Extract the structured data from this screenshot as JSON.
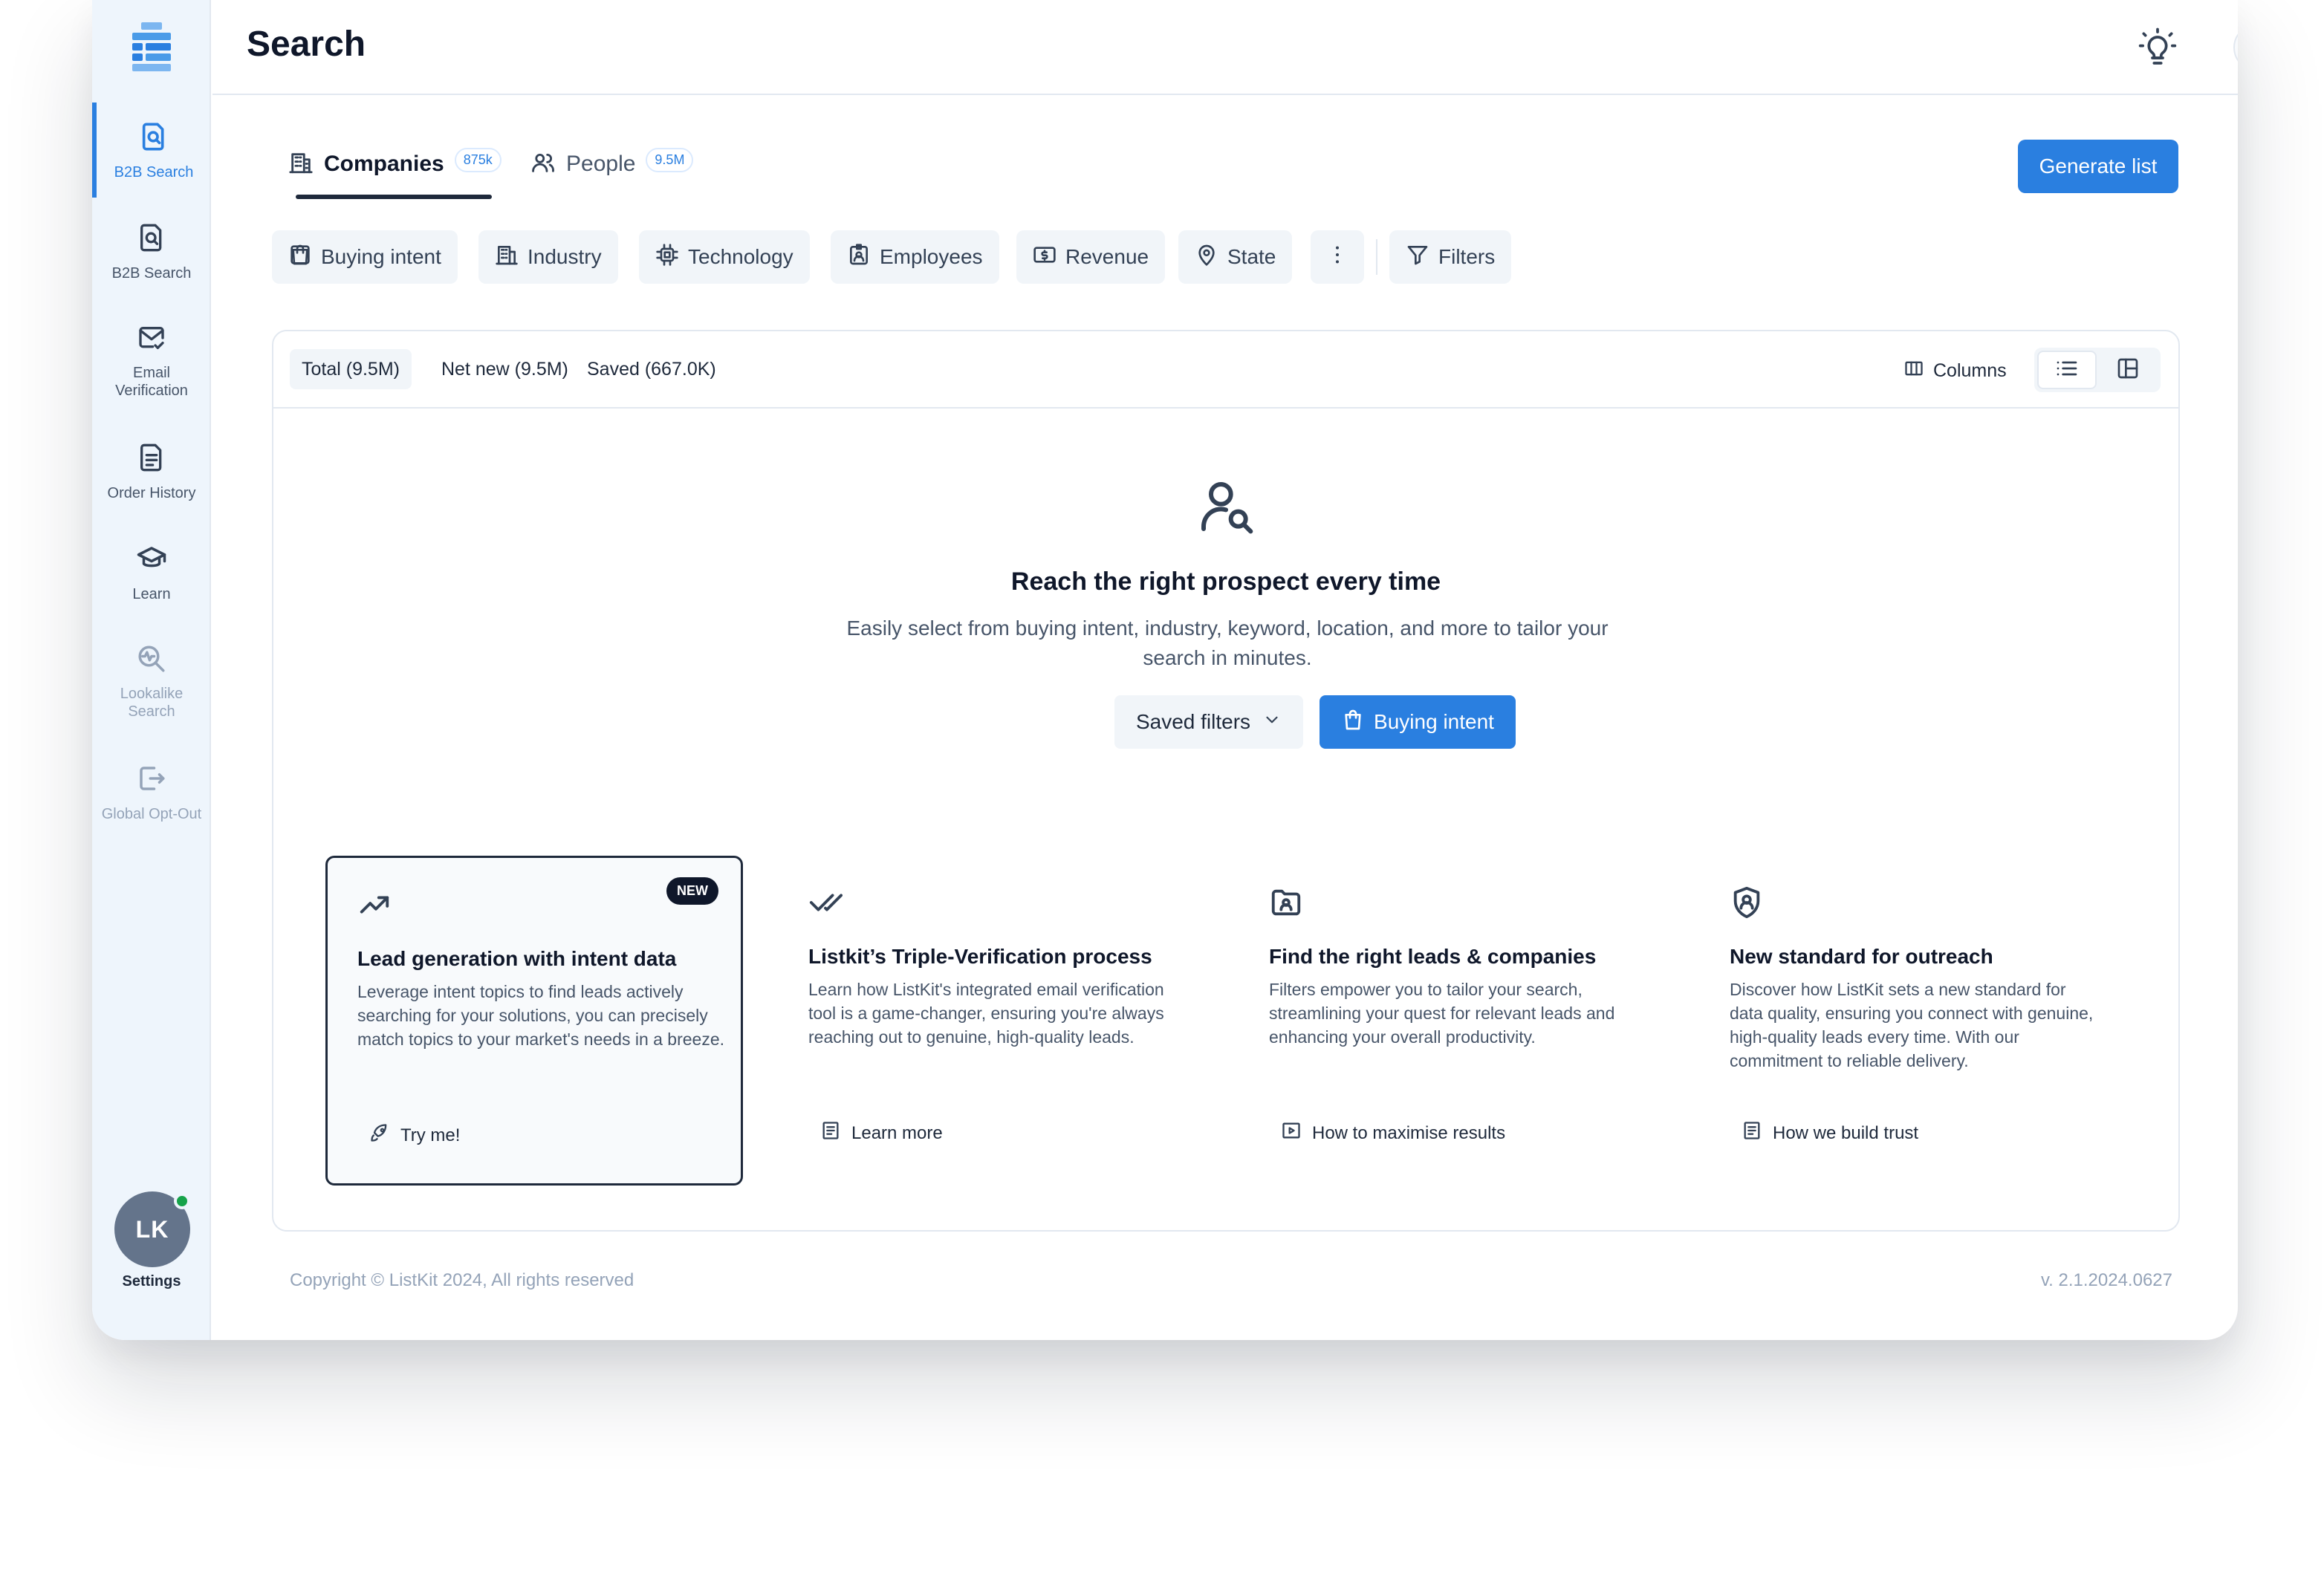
{
  "colors": {
    "accent": "#2a7fe0",
    "sidebar_bg": "#eef5fc",
    "dark": "#0f172a",
    "online": "#16a34a"
  },
  "sidebar": {
    "items": [
      {
        "label": "B2B Search",
        "icon": "search-document-icon",
        "active": true
      },
      {
        "label": "B2B Search",
        "icon": "search-document-icon",
        "active": false
      },
      {
        "label": "Email Verification",
        "icon": "mail-check-icon",
        "active": false
      },
      {
        "label": "Order History",
        "icon": "document-list-icon",
        "active": false
      },
      {
        "label": "Learn",
        "icon": "graduation-cap-icon",
        "active": false
      },
      {
        "label": "Lookalike Search",
        "icon": "lookalike-search-icon",
        "active": false,
        "muted": true
      },
      {
        "label": "Global Opt-Out",
        "icon": "logout-icon",
        "active": false,
        "muted": true
      }
    ],
    "avatar_initials": "LK",
    "settings_label": "Settings"
  },
  "header": {
    "title": "Search",
    "bulb_icon": "lightbulb-icon",
    "theme_icons": [
      "sun-icon",
      "moon-icon"
    ]
  },
  "tabs": [
    {
      "label": "Companies",
      "badge": "875k",
      "icon": "building-icon",
      "active": true
    },
    {
      "label": "People",
      "badge": "9.5M",
      "icon": "users-icon",
      "active": false
    }
  ],
  "generate_button": "Generate list",
  "filters": [
    {
      "label": "Buying intent",
      "icon": "shopping-bag-icon"
    },
    {
      "label": "Industry",
      "icon": "building-icon"
    },
    {
      "label": "Technology",
      "icon": "chip-icon"
    },
    {
      "label": "Employees",
      "icon": "id-badge-icon"
    },
    {
      "label": "Revenue",
      "icon": "dollar-note-icon"
    },
    {
      "label": "State",
      "icon": "map-pin-icon"
    },
    {
      "label": "",
      "icon": "more-vertical-icon"
    },
    {
      "label": "Filters",
      "icon": "funnel-icon"
    }
  ],
  "results": {
    "counts": [
      {
        "label": "Total (9.5M)",
        "active": true
      },
      {
        "label": "Net new (9.5M)",
        "active": false
      },
      {
        "label": "Saved (667.0K)",
        "active": false
      }
    ],
    "columns_label": "Columns",
    "empty_title": "Reach the right prospect every time",
    "empty_desc": "Easily select from buying intent, industry, keyword, location, and more to tailor your search in minutes.",
    "saved_filters_label": "Saved filters",
    "buying_intent_label": "Buying intent"
  },
  "cards": [
    {
      "icon": "trending-up-icon",
      "badge": "NEW",
      "title": "Lead generation with intent data",
      "desc": "Leverage intent topics to find leads actively searching for your solutions, you can precisely match topics to your market's needs in a breeze.",
      "link": "Try me!",
      "link_icon": "rocket-icon"
    },
    {
      "icon": "double-check-icon",
      "title": "Listkit’s Triple-Verification process",
      "desc": "Learn how ListKit's integrated email verification tool is a game-changer, ensuring you're always reaching out to genuine, high-quality leads.",
      "link": "Learn more",
      "link_icon": "article-icon"
    },
    {
      "icon": "folder-user-icon",
      "title": "Find the right leads & companies",
      "desc": "Filters empower you to tailor your search, streamlining your quest for relevant leads and enhancing your overall productivity.",
      "link": "How to maximise results",
      "link_icon": "video-play-icon"
    },
    {
      "icon": "shield-user-icon",
      "title": "New standard for outreach",
      "desc": "Discover how ListKit sets a new standard for data quality, ensuring you connect with genuine, high-quality leads every time. With our commitment to reliable delivery.",
      "link": "How we build trust",
      "link_icon": "article-icon"
    }
  ],
  "footer": {
    "copyright": "Copyright © ListKit 2024, All rights reserved",
    "version": "v. 2.1.2024.0627"
  }
}
